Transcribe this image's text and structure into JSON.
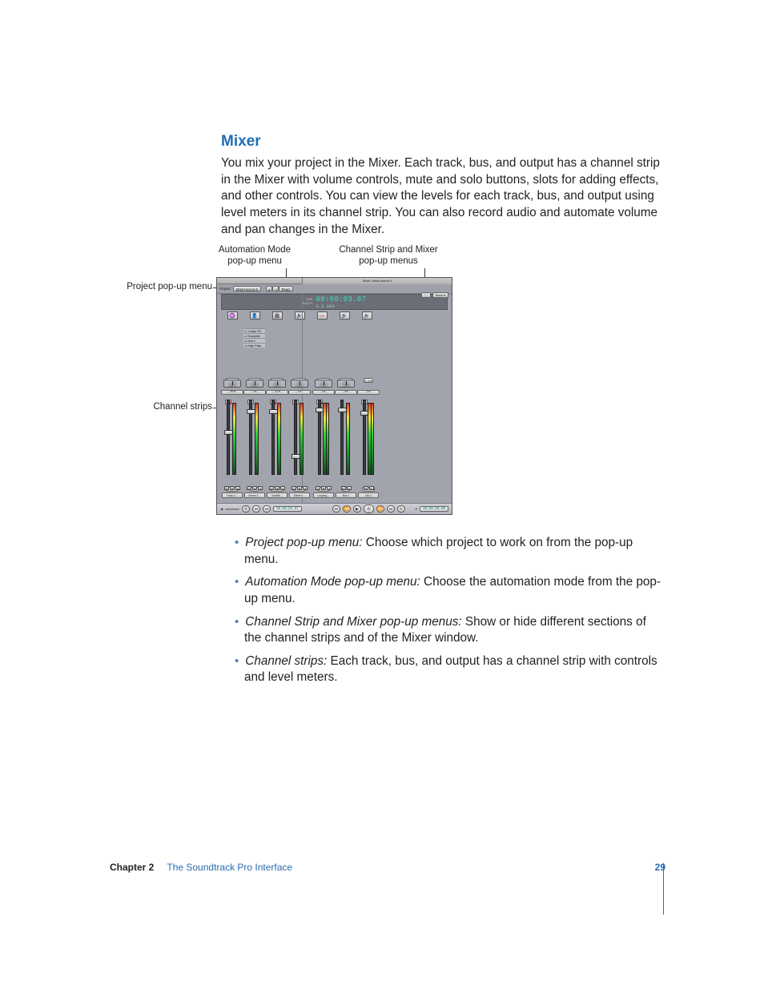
{
  "section": {
    "heading": "Mixer",
    "paragraph": "You mix your project in the Mixer. Each track, bus, and output has a channel strip in the Mixer with volume controls, mute and solo buttons, slots for adding effects, and other controls. You can view the levels for each track, bus, and output using level meters in its channel strip. You can also record audio and automate volume and pan changes in the Mixer."
  },
  "callouts": {
    "automation_l1": "Automation Mode",
    "automation_l2": "pop-up menu",
    "channel_mixer_l1": "Channel Strip and Mixer",
    "channel_mixer_l2": "pop-up menus",
    "project_popup": "Project pop-up menu",
    "channel_strips": "Channel strips"
  },
  "screenshot": {
    "header_center": "Mixer: Street scene 9",
    "toolbar": {
      "project_label": "Project:",
      "project_value": "Street scene 9",
      "read_button": "Read",
      "right1": "⬚",
      "right2": "Show ▾"
    },
    "time": {
      "l1_label": "TIME",
      "tc": "00:00:03.07",
      "l2_label": "BEATS",
      "beats": "2.3.193"
    },
    "fx": [
      "▹1 Limiter Pk",
      "▹2 Expander",
      "▹3 Dist 2",
      "▹4 High Pass"
    ],
    "outs": [
      "Out 1  ▾",
      "Out 1  ▾",
      "Out 1  ▾",
      "Out 1  ▾",
      "Out 1  ▾",
      "Out 1  ▾",
      "1, 2  ▾"
    ],
    "db": [
      "-26 ▾",
      "0 ▾",
      "-32 ▾",
      "0 ▾",
      "0 ▾",
      "0 ▾",
      "0 ▾"
    ],
    "gain": [
      "-2.5",
      "0",
      "-1.75",
      "-.38",
      "-.01",
      "0",
      "-4.74"
    ],
    "names": [
      "Track 4…",
      "Scene 3…",
      "Transiti…",
      "Street n…",
      "Looping…",
      "Bus 1",
      "Out 1"
    ],
    "transport": {
      "tc_left": "00:00:03.07",
      "tc_right": "00:00:00.00"
    }
  },
  "bullets": [
    {
      "term": "Project pop-up menu:",
      "text": "  Choose which project to work on from the pop-up menu."
    },
    {
      "term": "Automation Mode pop-up menu:",
      "text": "  Choose the automation mode from the pop-up menu."
    },
    {
      "term": "Channel Strip and Mixer pop-up menus:",
      "text": "  Show or hide different sections of the channel strips and of the Mixer window."
    },
    {
      "term": "Channel strips:",
      "text": "  Each track, bus, and output has a channel strip with controls and level meters."
    }
  ],
  "footer": {
    "chapter": "Chapter 2",
    "title": "The Soundtrack Pro Interface",
    "page": "29"
  }
}
